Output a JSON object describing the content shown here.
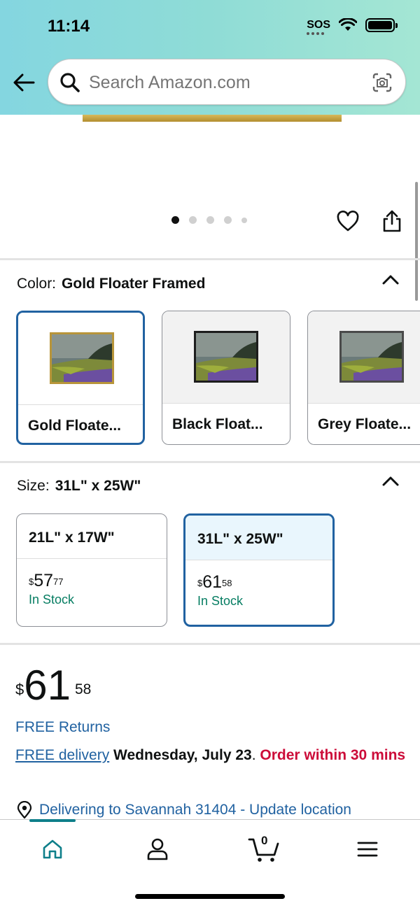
{
  "status_bar": {
    "time": "11:14",
    "sos": "SOS"
  },
  "search": {
    "placeholder": "Search Amazon.com"
  },
  "gallery": {
    "image_count": 5,
    "active_index": 0
  },
  "color": {
    "label": "Color:",
    "selected": "Gold Floater Framed",
    "options": [
      {
        "name": "Gold Floate...",
        "frame": "#b8953a"
      },
      {
        "name": "Black Float...",
        "frame": "#1d1d1d"
      },
      {
        "name": "Grey Floate...",
        "frame": "#4a4a4a"
      }
    ]
  },
  "size": {
    "label": "Size:",
    "selected": "31L\" x 25W\"",
    "options": [
      {
        "name": "21L\" x 17W\"",
        "dollars": "57",
        "cents": "77",
        "currency": "$",
        "stock": "In Stock"
      },
      {
        "name": "31L\" x 25W\"",
        "dollars": "61",
        "cents": "58",
        "currency": "$",
        "stock": "In Stock"
      }
    ]
  },
  "price": {
    "currency": "$",
    "dollars": "61",
    "cents": "58"
  },
  "returns": "FREE Returns",
  "delivery": {
    "link": "FREE delivery",
    "date": "Wednesday, July 23",
    "sep": ". ",
    "order": "Order within 30 mins"
  },
  "location": "Delivering to Savannah 31404 - Update location",
  "nav": {
    "cart_count": "0"
  },
  "colors": {
    "link": "#2162a1",
    "stock": "#067d62",
    "urgent": "#cc0c39",
    "selected_border": "#2162a1"
  }
}
